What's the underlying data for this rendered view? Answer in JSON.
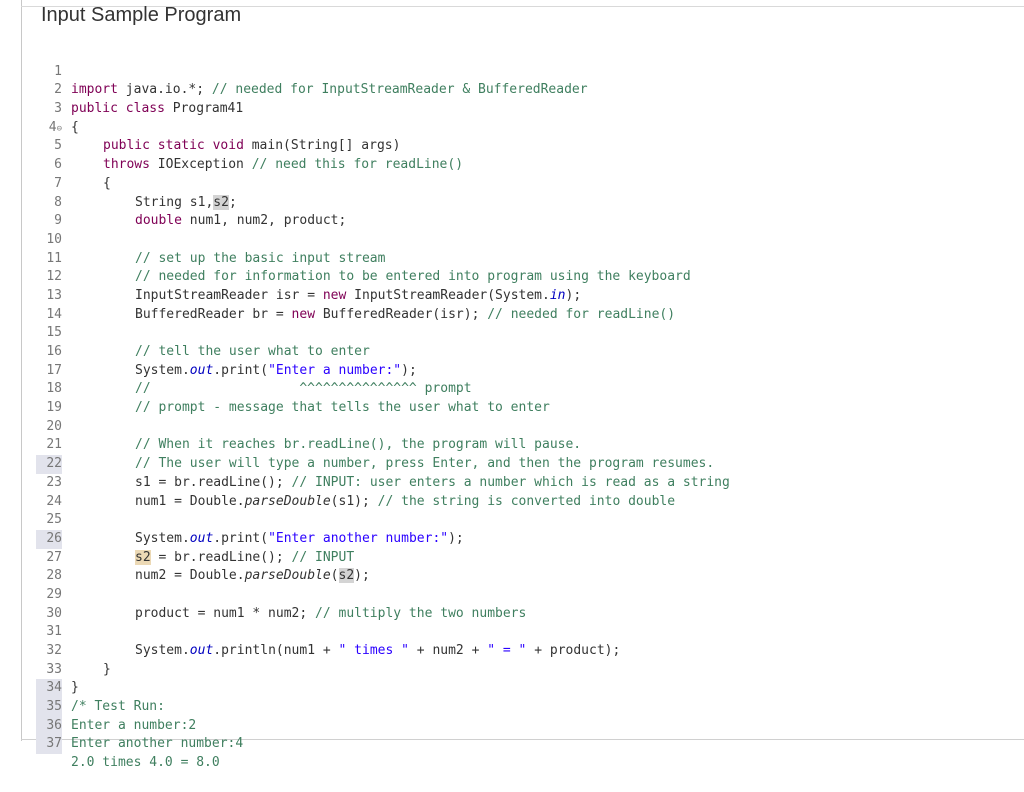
{
  "page": {
    "title": "Input Sample Program"
  },
  "code": {
    "line_numbers": [
      "1",
      "2",
      "3",
      "4",
      "5",
      "6",
      "7",
      "8",
      "9",
      "10",
      "11",
      "12",
      "13",
      "14",
      "15",
      "16",
      "17",
      "18",
      "19",
      "20",
      "21",
      "22",
      "23",
      "24",
      "25",
      "26",
      "27",
      "28",
      "29",
      "30",
      "31",
      "32",
      "33",
      "34",
      "35",
      "36",
      "37"
    ],
    "fold_marker": "⊖",
    "l1": {
      "import": "import",
      "pkg": " java.io.*; ",
      "comment": "// needed for InputStreamReader & BufferedReader"
    },
    "l2": {
      "public": "public",
      "class": "class",
      "name": " Program41"
    },
    "l3": "{",
    "l4": {
      "public": "public",
      "static": "static",
      "void": "void",
      "sig": " main(String[] args)"
    },
    "l5": {
      "throws": "throws",
      "exc": " IOException ",
      "comment": "// need this for readLine()"
    },
    "l6": "{",
    "l7": {
      "type": "String ",
      "a": "s1,",
      "b": "s2",
      "end": ";"
    },
    "l8": {
      "double": "double",
      "rest": " num1, num2, product;"
    },
    "l10": "// set up the basic input stream",
    "l11": "// needed for information to be entered into program using the keyboard",
    "l12": {
      "a": "InputStreamReader ",
      "isr": "isr",
      "b": " = ",
      "new": "new",
      "c": " InputStreamReader(System.",
      "in": "in",
      "d": ");"
    },
    "l13": {
      "a": "BufferedReader br = ",
      "new": "new",
      "b": " BufferedReader(isr); ",
      "comment": "// needed for readLine()"
    },
    "l15": "// tell the user what to enter",
    "l16": {
      "a": "System.",
      "out": "out",
      "b": ".print(",
      "str": "\"Enter a number:\"",
      "c": ");"
    },
    "l17": "//                   ^^^^^^^^^^^^^^^ prompt",
    "l18": "// prompt - message that tells the user what to enter",
    "l20": "// When it reaches br.readLine(), the program will pause.",
    "l21": "// The user will type a number, press Enter, and then the program resumes.",
    "l22": {
      "a": "s1 = br.readLine(); ",
      "comment": "// INPUT: user enters a number which is read as a string"
    },
    "l23": {
      "a": "num1 = Double.",
      "fn": "parseDouble",
      "b": "(s1); ",
      "comment": "// the string is converted into double"
    },
    "l25": {
      "a": "System.",
      "out": "out",
      "b": ".print(",
      "str": "\"Enter another number:\"",
      "c": ");"
    },
    "l26": {
      "s2": "s2",
      "a": " = br.readLine(); ",
      "comment": "// INPUT"
    },
    "l27": {
      "a": "num2 = Double.",
      "fn": "parseDouble",
      "b": "(",
      "s2": "s2",
      "c": ");"
    },
    "l29": {
      "a": "product = num1 * num2; ",
      "comment": "// multiply the two numbers"
    },
    "l31": {
      "a": "System.",
      "out": "out",
      "b": ".println(num1 + ",
      "s1": "\" times \"",
      "c": " + num2 + ",
      "s2": "\" = \"",
      "d": " + product);"
    },
    "l32": "}",
    "l33": "}",
    "l34": "/* Test Run:",
    "l35": "Enter a number:2",
    "l36": "Enter another number:4",
    "l37": "2.0 times 4.0 = 8.0"
  }
}
